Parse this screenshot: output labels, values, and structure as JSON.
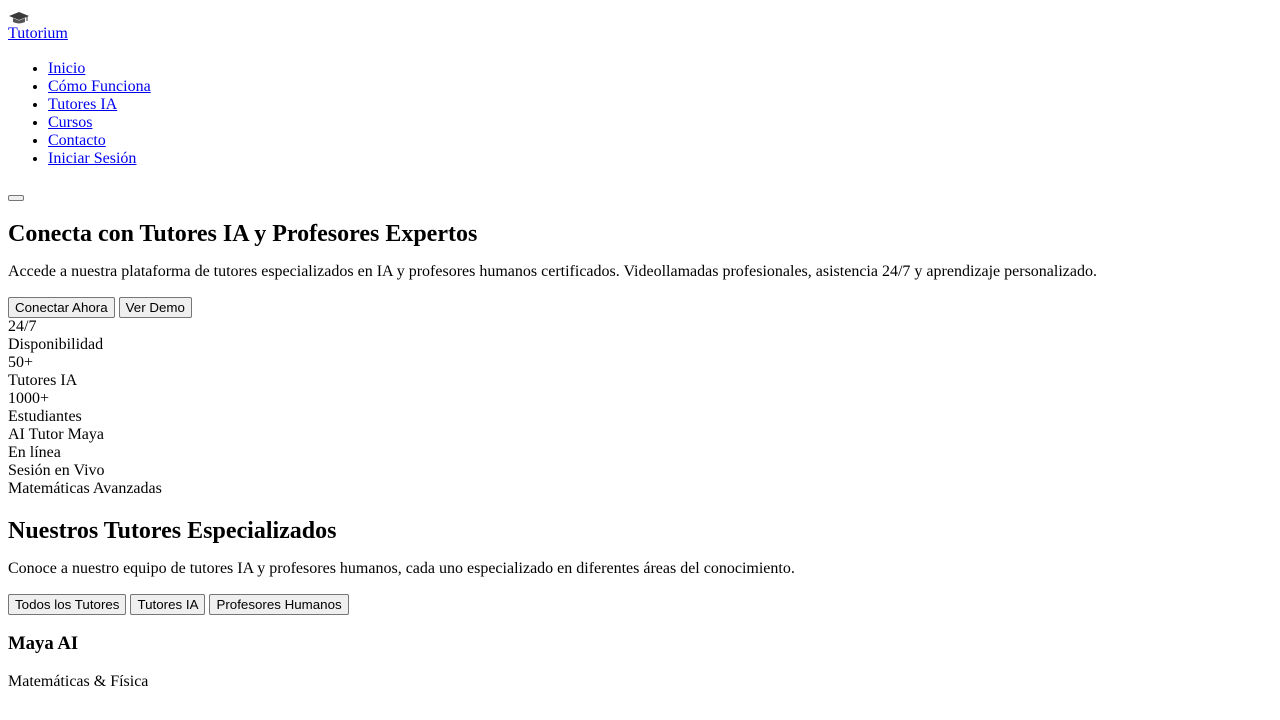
{
  "brand": {
    "icon": "graduation-cap-icon",
    "name": "Tutorium"
  },
  "nav": {
    "items": [
      {
        "label": "Inicio"
      },
      {
        "label": "Cómo Funciona"
      },
      {
        "label": "Tutores IA"
      },
      {
        "label": "Cursos"
      },
      {
        "label": "Contacto"
      },
      {
        "label": "Iniciar Sesión"
      }
    ]
  },
  "hero": {
    "title": "Conecta con Tutores IA y Profesores Expertos",
    "description": "Accede a nuestra plataforma de tutores especializados en IA y profesores humanos certificados. Videollamadas profesionales, asistencia 24/7 y aprendizaje personalizado.",
    "primary_cta": "Conectar Ahora",
    "secondary_cta": "Ver Demo",
    "stats": [
      {
        "value": "24/7",
        "label": "Disponibilidad"
      },
      {
        "value": "50+",
        "label": "Tutores IA"
      },
      {
        "value": "1000+",
        "label": "Estudiantes"
      }
    ],
    "live_card": {
      "tutor_name": "AI Tutor Maya",
      "status": "En línea",
      "session_label": "Sesión en Vivo",
      "subject": "Matemáticas Avanzadas"
    }
  },
  "tutors_section": {
    "title": "Nuestros Tutores Especializados",
    "description": "Conoce a nuestro equipo de tutores IA y profesores humanos, cada uno especializado en diferentes áreas del conocimiento.",
    "filters": [
      {
        "label": "Todos los Tutores"
      },
      {
        "label": "Tutores IA"
      },
      {
        "label": "Profesores Humanos"
      }
    ],
    "tutors": [
      {
        "name": "Maya AI",
        "subject": "Matemáticas & Física"
      }
    ]
  }
}
